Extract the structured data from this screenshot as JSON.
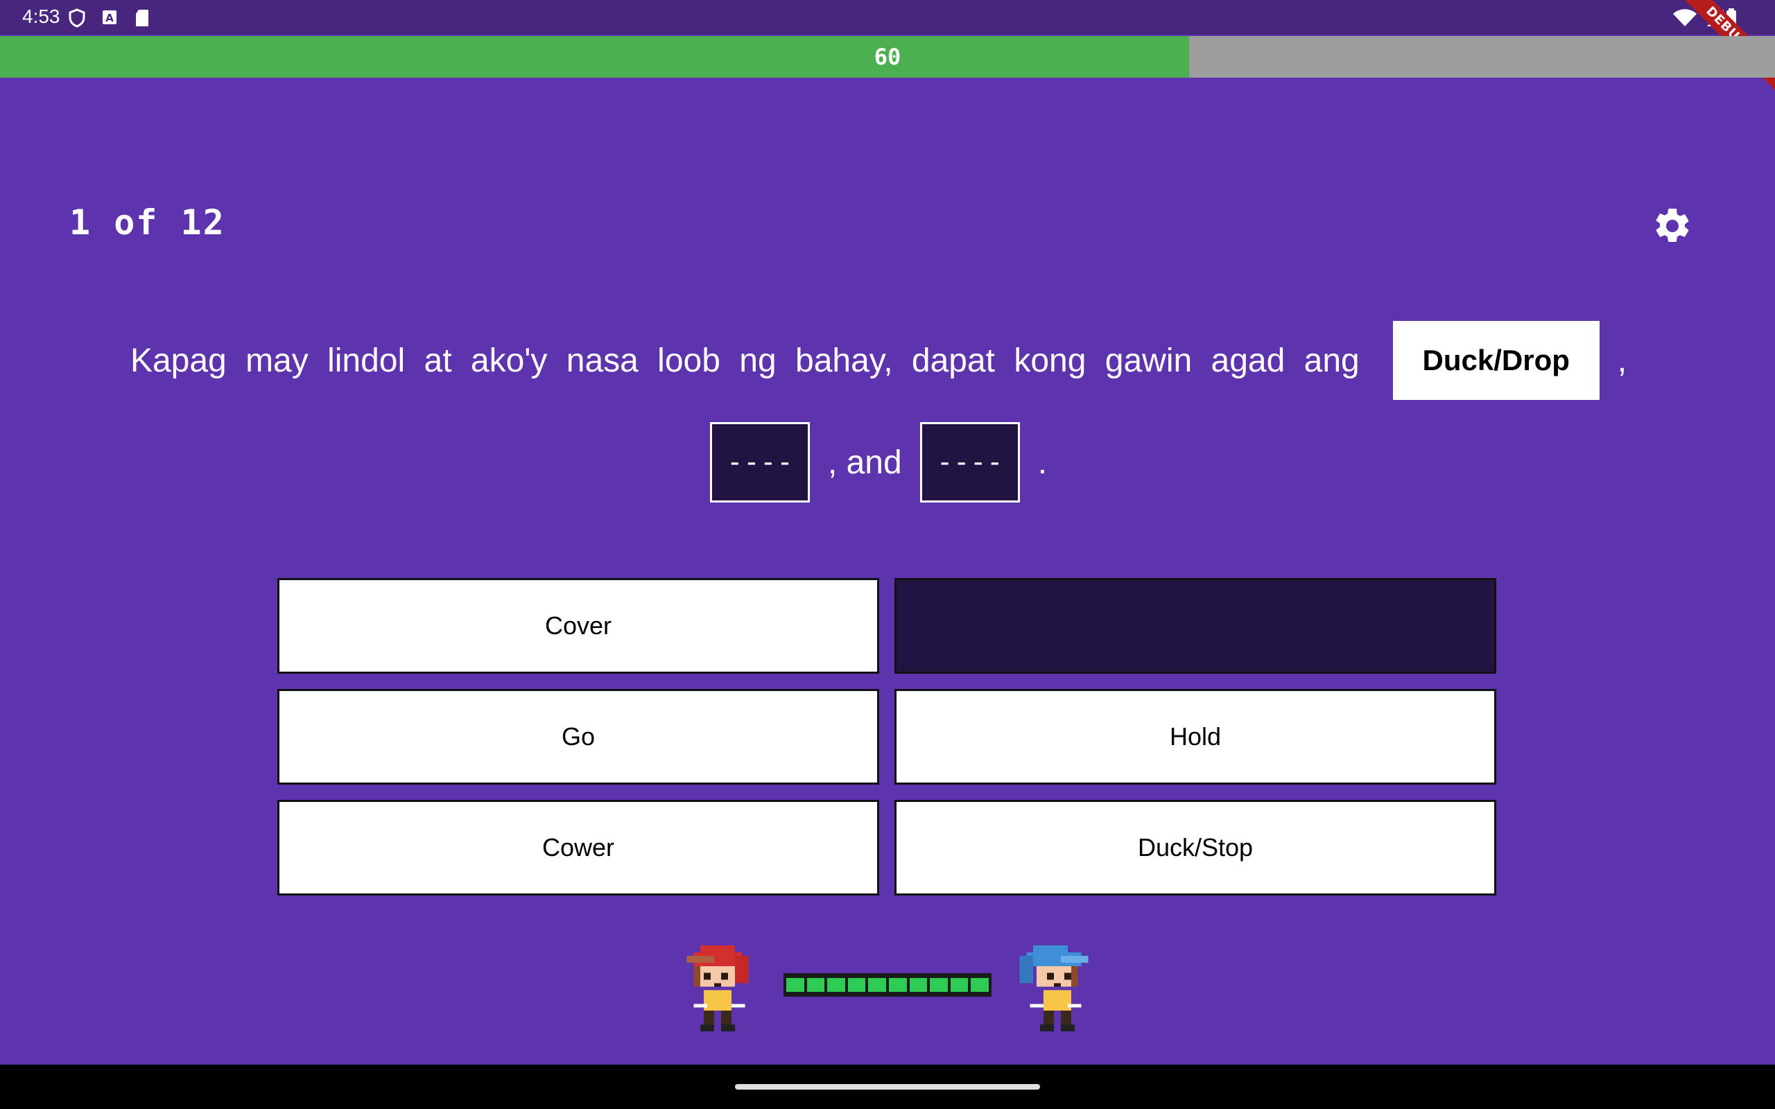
{
  "status_bar": {
    "time": "4:53",
    "icons": [
      "shield-icon",
      "a-badge-icon",
      "sd-card-icon",
      "wifi-icon",
      "signal-icon",
      "battery-icon"
    ],
    "debug_label": "DEBUG"
  },
  "timer": {
    "value": "60",
    "fraction": 0.67
  },
  "header": {
    "progress": "1 of 12",
    "settings_icon": "gear-icon"
  },
  "question": {
    "text": "Kapag may lindol at ako'y nasa loob ng bahay, dapat kong gawin agad ang",
    "answers": [
      "Duck/Drop",
      "----",
      "----"
    ],
    "separator_comma_1": ",",
    "separator_and": ", and",
    "separator_end": "."
  },
  "options": [
    {
      "label": "Cover",
      "used": false
    },
    {
      "label": "",
      "used": true
    },
    {
      "label": "Go",
      "used": false
    },
    {
      "label": "Hold",
      "used": false
    },
    {
      "label": "Cower",
      "used": false
    },
    {
      "label": "Duck/Stop",
      "used": false
    }
  ],
  "battle": {
    "player_health_segments": 10,
    "colors": {
      "player_hair": "#d32f2f",
      "enemy_hair": "#3f8fd8",
      "health": "#2ecc55"
    }
  },
  "colors": {
    "background": "#5e33ae",
    "status_bar": "#48267e",
    "timer_fill": "#4caf50",
    "timer_track": "#9e9e9e",
    "slot_empty": "#211443"
  }
}
